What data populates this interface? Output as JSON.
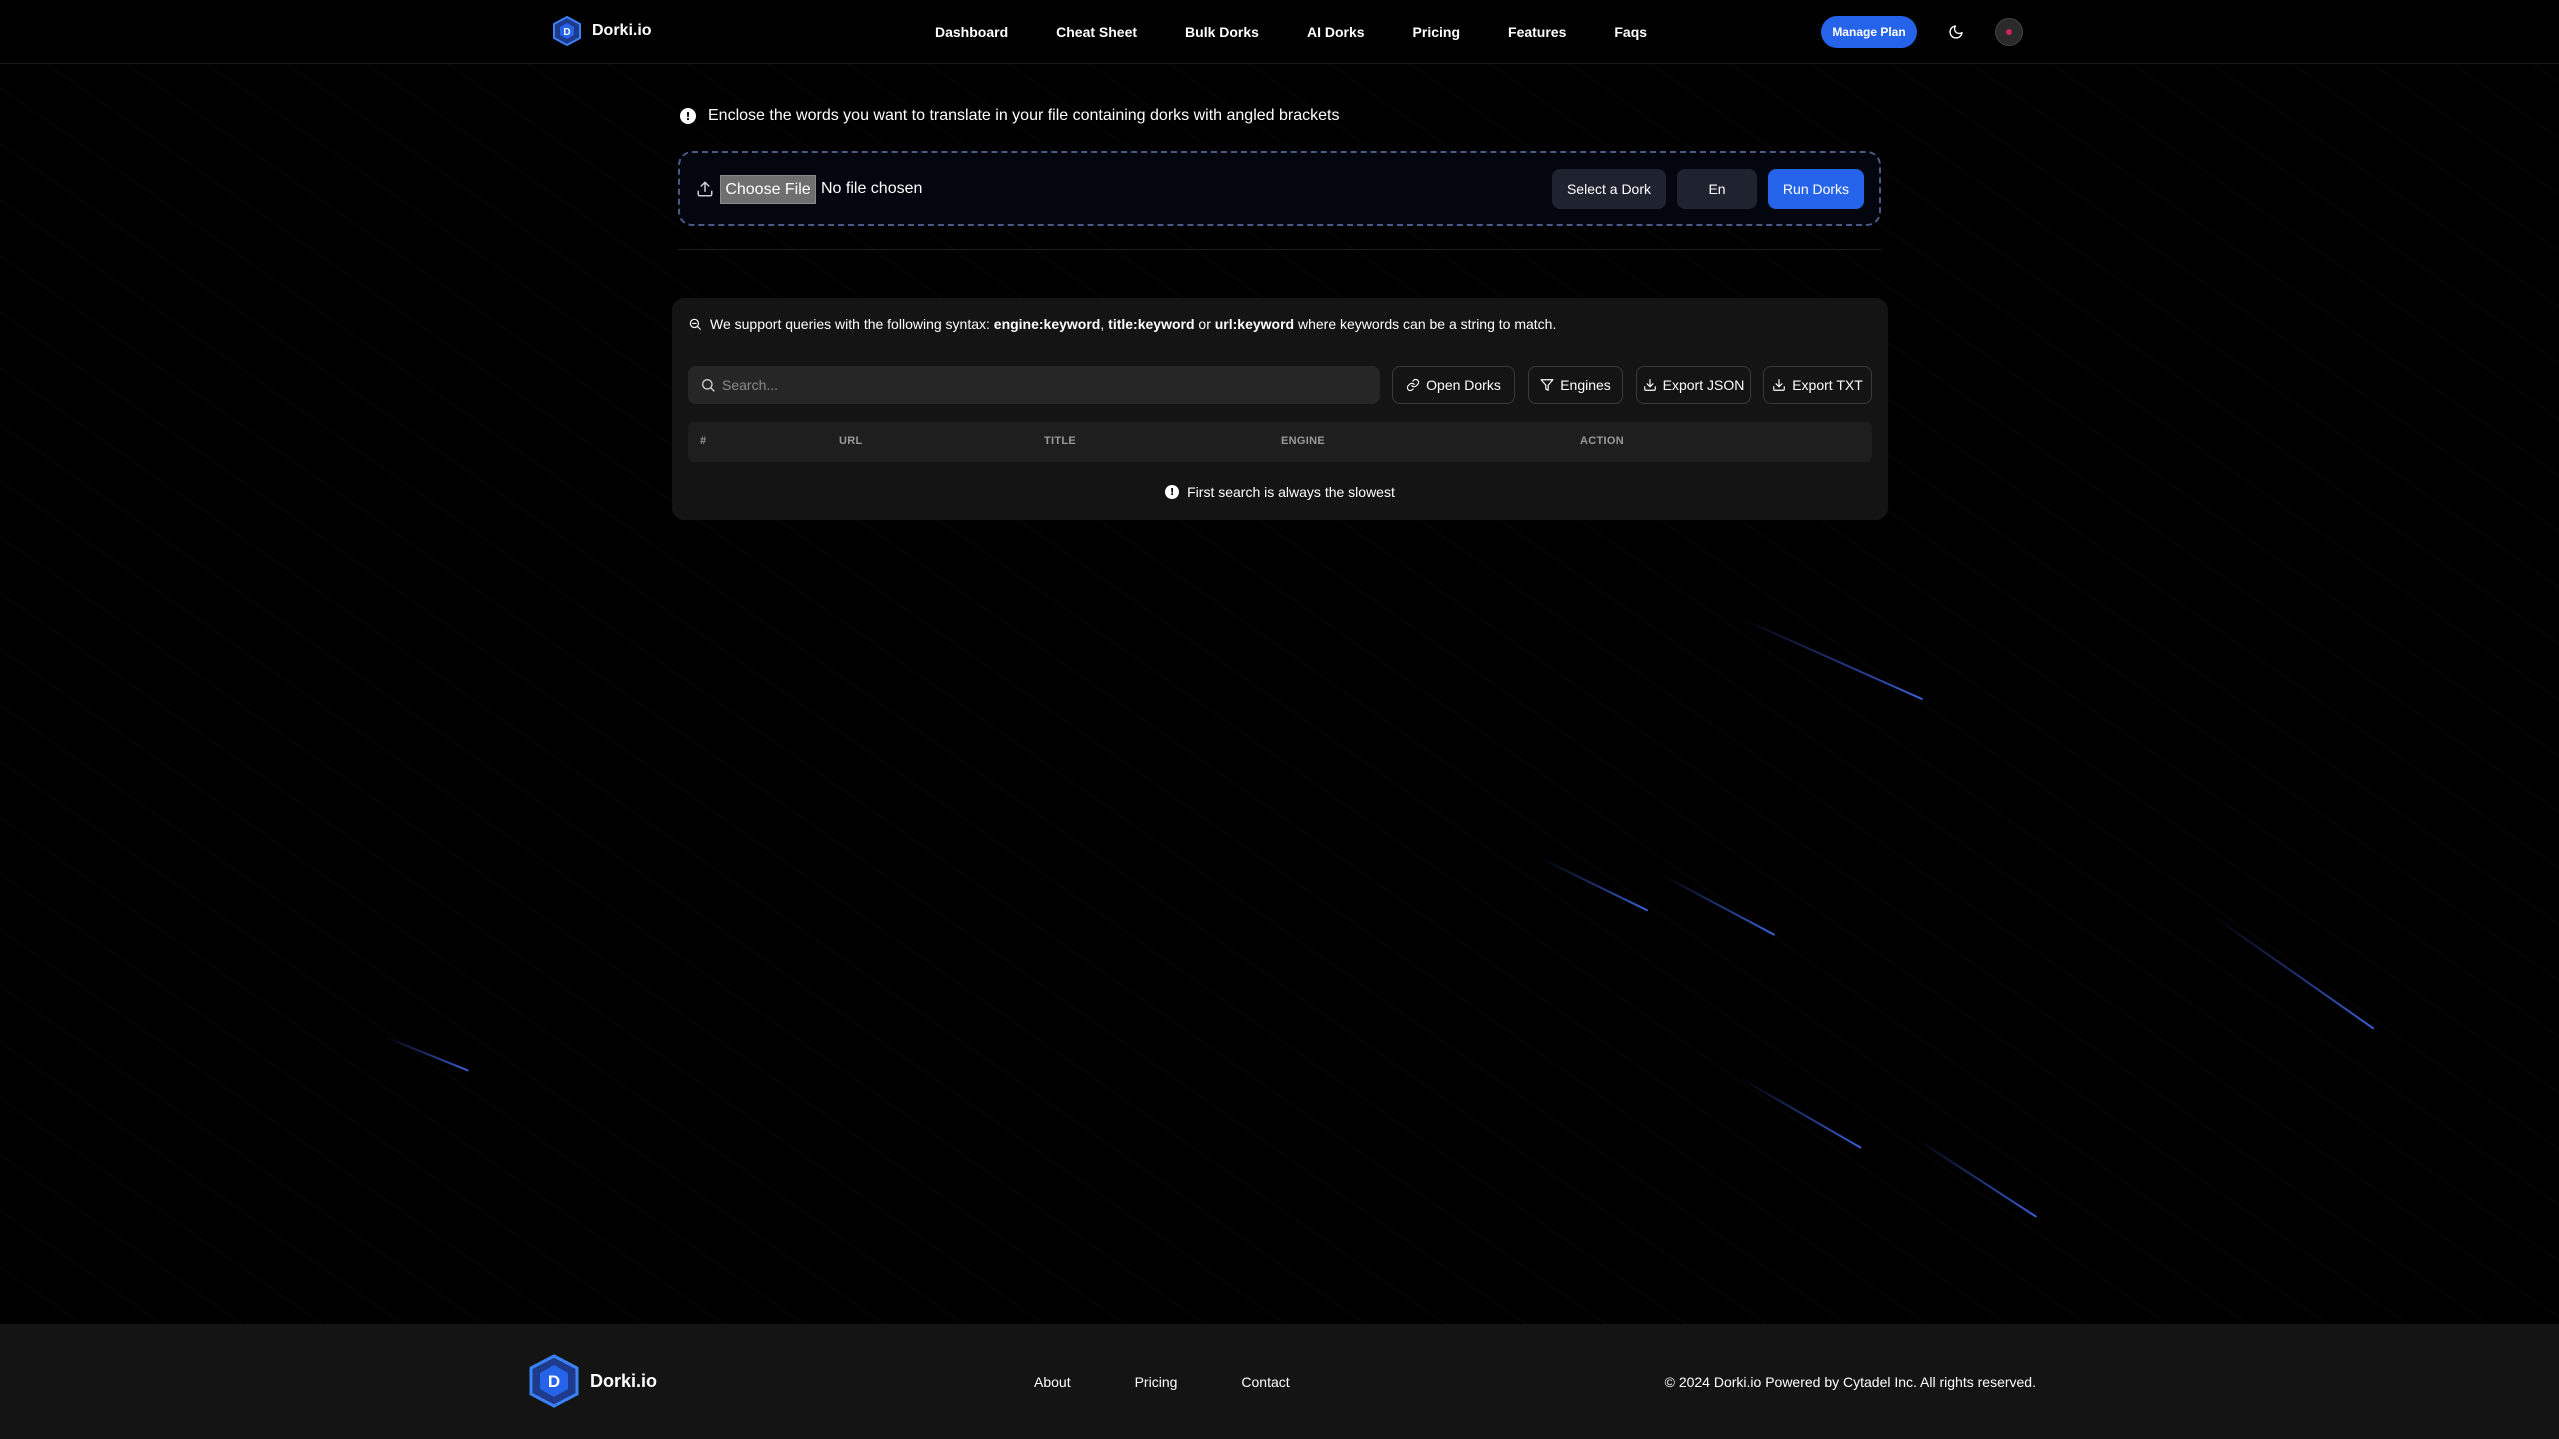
{
  "header": {
    "brand": "Dorki.io",
    "nav": [
      "Dashboard",
      "Cheat Sheet",
      "Bulk Dorks",
      "AI Dorks",
      "Pricing",
      "Features",
      "Faqs"
    ],
    "manage_plan": "Manage Plan",
    "theme_icon": "moon-icon",
    "avatar_icon": "user-avatar"
  },
  "notice": {
    "text": "Enclose the words you want to translate in your file containing dorks with angled brackets",
    "icon": "info-icon"
  },
  "upload": {
    "choose_file": "Choose File",
    "no_file": "No file chosen",
    "select_dork": "Select a Dork",
    "language": "En",
    "run": "Run Dorks"
  },
  "results": {
    "syntax_prefix": "We support queries with the following syntax:",
    "syntax_engine": "engine:keyword",
    "syntax_sep1": ",",
    "syntax_title": "title:keyword",
    "syntax_or": "or",
    "syntax_url": "url:keyword",
    "syntax_suffix": "where keywords can be a string to match.",
    "search_placeholder": "Search...",
    "buttons": {
      "open_dorks": "Open Dorks",
      "engines": "Engines",
      "export_json": "Export JSON",
      "export_txt": "Export TXT"
    },
    "columns": [
      "#",
      "URL",
      "TITLE",
      "ENGINE",
      "ACTION"
    ],
    "empty_message": "First search is always the slowest"
  },
  "footer": {
    "brand": "Dorki.io",
    "links": [
      "About",
      "Pricing",
      "Contact"
    ],
    "copyright": "© 2024 Dorki.io Powered by Cytadel Inc. All rights reserved."
  },
  "colors": {
    "accent": "#2563eb",
    "panel": "#141414",
    "background": "#000000"
  }
}
